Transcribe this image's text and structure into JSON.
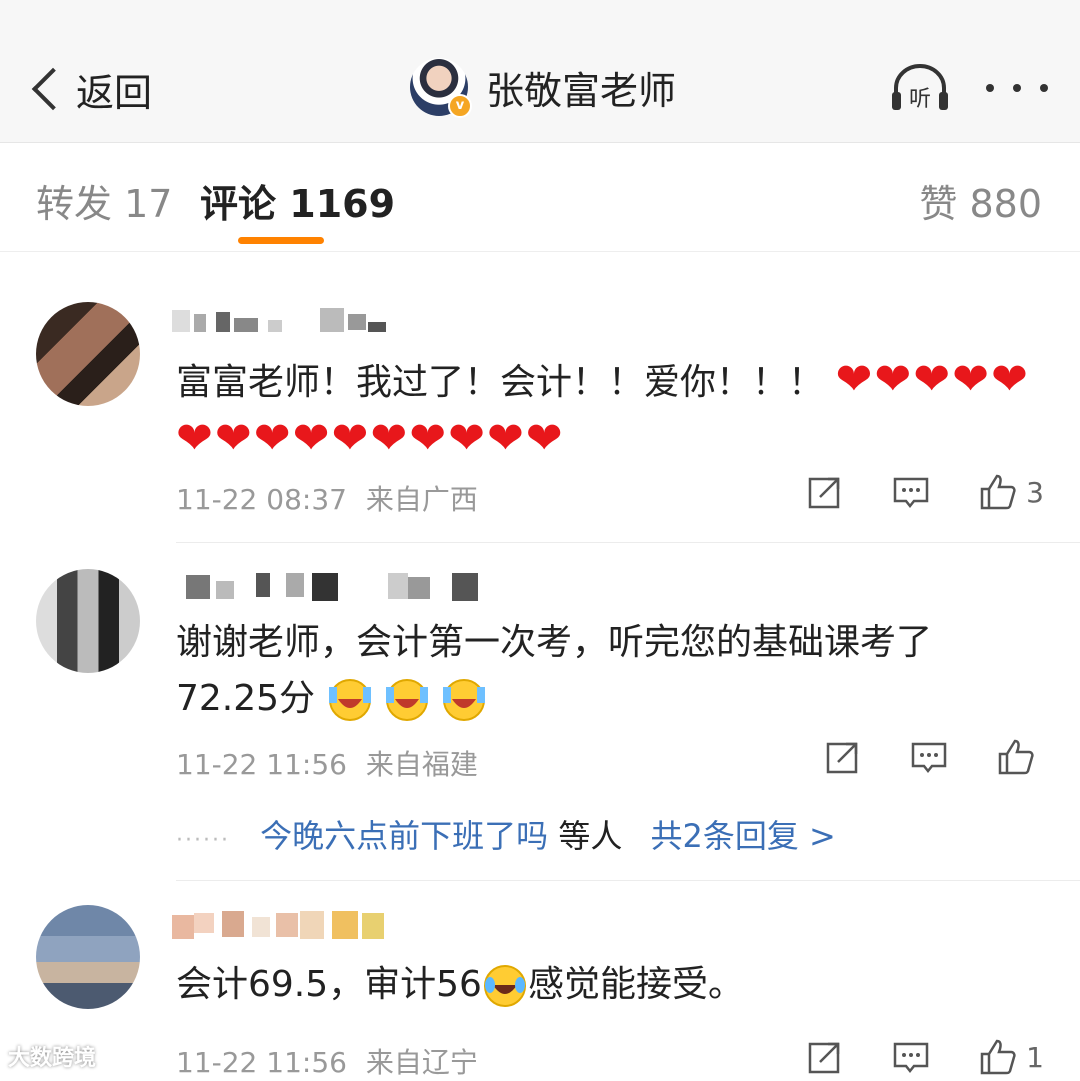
{
  "header": {
    "back_label": "返回",
    "author_name": "张敬富老师",
    "listen_label": "听"
  },
  "tabs": {
    "repost_label": "转发",
    "repost_count": "17",
    "comments_label": "评论",
    "comments_count": "1169",
    "likes_label": "赞",
    "likes_count": "880"
  },
  "comments": [
    {
      "text": "富富老师！我过了！会计！！爱你！！！",
      "hearts": "❤❤❤❤❤❤❤❤❤❤❤❤❤❤❤",
      "time": "11-22 08:37",
      "source": "来自广西",
      "likes": "3"
    },
    {
      "text_line1": "谢谢老师，会计第一次考，听完您的基础课考了",
      "text_line2": "72.25分",
      "time": "11-22 11:56",
      "source": "来自福建",
      "likes": "",
      "replies_preview": "今晚六点前下班了吗",
      "replies_suffix": "等人",
      "replies_more": "共2条回复 >"
    },
    {
      "text_a": "会计69.5，审计56",
      "text_b": "感觉能接受。",
      "time": "11-22 11:56",
      "source": "来自辽宁",
      "likes": "1"
    }
  ],
  "watermark": "大数跨境",
  "colors": {
    "accent": "#ff8200",
    "link": "#3b6fb6",
    "heart": "#e8171b"
  }
}
